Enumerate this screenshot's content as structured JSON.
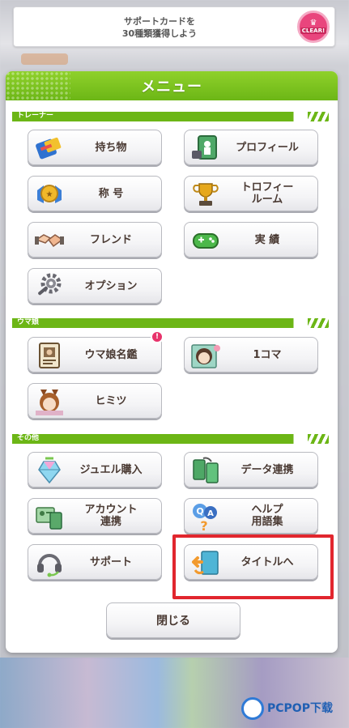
{
  "banner": {
    "text": "サポートカードを\n30種類獲得しよう",
    "badge": "CLEAR!"
  },
  "menu": {
    "title": "メニュー",
    "sections": {
      "trainer": "トレーナー",
      "umamusume": "ウマ娘",
      "other": "その他"
    },
    "buttons": {
      "items": "持ち物",
      "profile": "プロフィール",
      "title": "称 号",
      "trophy_room": "トロフィー\nルーム",
      "friend": "フレンド",
      "achievements": "実 績",
      "options": "オプション",
      "uma_encyclopedia": "ウマ娘名鑑",
      "one_frame": "1コマ",
      "secrets": "ヒミツ",
      "jewel_purchase": "ジュエル購入",
      "data_link": "データ連携",
      "account_link": "アカウント\n連携",
      "help": "ヘルプ\n用語集",
      "support": "サポート",
      "to_title": "タイトルへ"
    },
    "encyclopedia_badge": "!",
    "close": "閉じる"
  },
  "watermark": {
    "text": "PCPOP下载"
  },
  "colors": {
    "accent_green": "#6cb616",
    "highlight_red": "#e1262e",
    "badge_pink": "#e8336b"
  }
}
